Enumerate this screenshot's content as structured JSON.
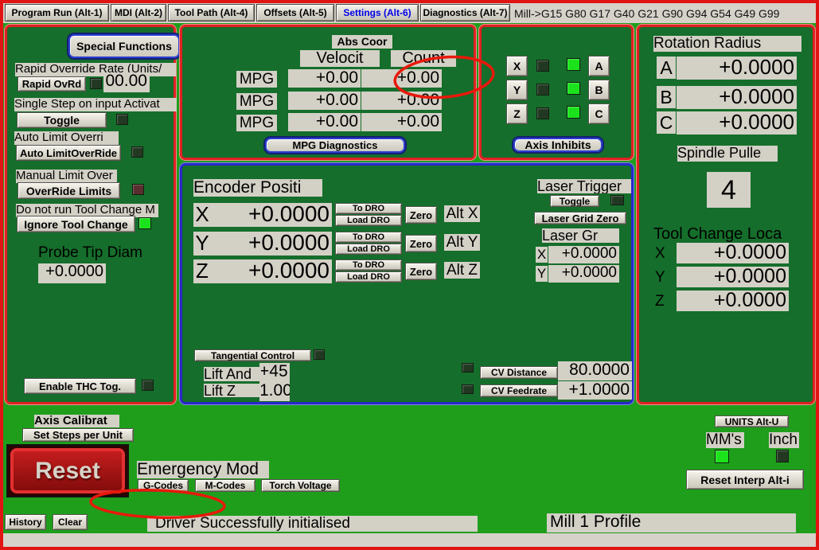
{
  "tabs": [
    {
      "label": "Program Run (Alt-1)"
    },
    {
      "label": "MDI (Alt-2)"
    },
    {
      "label": "Tool Path (Alt-4)"
    },
    {
      "label": "Offsets (Alt-5)"
    },
    {
      "label": "Settings (Alt-6)"
    },
    {
      "label": "Diagnostics (Alt-7)"
    }
  ],
  "gcode_line": "Mill->G15  G80 G17 G40 G21 G90 G94 G54 G49 G99",
  "special_functions": {
    "title": "Special Functions",
    "rapid_override_label": "Rapid Override Rate (Units/",
    "rapid_ovrd_button": "Rapid OvRd",
    "rapid_ovrd_value": "00.00",
    "single_step_label": "Single Step on input Activat",
    "single_step_button": "Toggle",
    "auto_limit_label": "Auto Limit Overri",
    "auto_limit_button": "Auto LimitOverRide",
    "manual_limit_label": "Manual Limit Over",
    "manual_limit_button": "OverRide Limits",
    "tool_change_label": "Do not run Tool Change M",
    "tool_change_button": "Ignore Tool Change",
    "probe_tip_label": "Probe Tip Diam",
    "probe_tip_value": "+0.0000",
    "thc_button": "Enable THC Tog."
  },
  "mpg": {
    "title": "Abs Coor",
    "velocity_header": "Velocit",
    "count_header": "Count",
    "rows": [
      {
        "label": "MPG",
        "velocity": "+0.00",
        "count": "+0.00"
      },
      {
        "label": "MPG",
        "velocity": "+0.00",
        "count": "+0.00"
      },
      {
        "label": "MPG",
        "velocity": "+0.00",
        "count": "+0.00"
      }
    ],
    "diagnostics_button": "MPG Diagnostics"
  },
  "axis_inhibits": {
    "left_axes": [
      "X",
      "Y",
      "Z"
    ],
    "right_axes": [
      "A",
      "B",
      "C"
    ],
    "title_button": "Axis Inhibits"
  },
  "rotation": {
    "title": "Rotation Radius",
    "rows": [
      {
        "axis": "A",
        "value": "+0.0000"
      },
      {
        "axis": "B",
        "value": "+0.0000"
      },
      {
        "axis": "C",
        "value": "+0.0000"
      }
    ],
    "spindle_label": "Spindle Pulle",
    "spindle_value": "4"
  },
  "tool_change": {
    "title": "Tool Change Loca",
    "rows": [
      {
        "axis": "X",
        "value": "+0.0000"
      },
      {
        "axis": "Y",
        "value": "+0.0000"
      },
      {
        "axis": "Z",
        "value": "+0.0000"
      }
    ]
  },
  "encoder": {
    "title": "Encoder Positi",
    "rows": [
      {
        "axis": "X",
        "value": "+0.0000",
        "to_dro": "To DRO",
        "load_dro": "Load DRO",
        "zero": "Zero",
        "alt": "Alt X"
      },
      {
        "axis": "Y",
        "value": "+0.0000",
        "to_dro": "To DRO",
        "load_dro": "Load DRO",
        "zero": "Zero",
        "alt": "Alt Y"
      },
      {
        "axis": "Z",
        "value": "+0.0000",
        "to_dro": "To DRO",
        "load_dro": "Load DRO",
        "zero": "Zero",
        "alt": "Alt Z"
      }
    ]
  },
  "laser": {
    "trigger_label": "Laser Trigger",
    "toggle_button": "Toggle",
    "grid_zero_button": "Laser Grid Zero",
    "grid_label": "Laser Gr",
    "x_label": "X",
    "x_value": "+0.0000",
    "y_label": "Y",
    "y_value": "+0.0000"
  },
  "tangential": {
    "button": "Tangential Control",
    "lift_angle_label": "Lift And",
    "lift_angle_value": "+45",
    "lift_z_label": "Lift Z",
    "lift_z_value": "1.00"
  },
  "cv": {
    "distance_button": "CV Distance",
    "distance_value": "80.0000",
    "feedrate_button": "CV Feedrate",
    "feedrate_value": "+1.0000"
  },
  "bottom": {
    "axis_calibration_label": "Axis Calibrat",
    "set_steps_button": "Set Steps per Unit",
    "reset_button": "Reset",
    "emergency_label": "Emergency Mod",
    "gcodes_button": "G-Codes",
    "mcodes_button": "M-Codes",
    "torch_button": "Torch Voltage",
    "units_button": "UNITS Alt-U",
    "mm_label": "MM's",
    "inch_label": "Inch",
    "reset_interp_button": "Reset Interp Alt-i",
    "history_button": "History",
    "clear_button": "Clear",
    "status_text": "Driver Successfully initialised",
    "profile_text": "Mill  1  Profile"
  },
  "colors": {
    "background_green": "#1f9e1c",
    "panel_green": "#156e2b",
    "window_border_red": "#e11414",
    "panel_border_red": "#df2121",
    "encoder_border_blue": "#2628c8",
    "ui_gray": "#d3d0c6",
    "led_on": "#1be31b",
    "led_off": "#233823",
    "led_maroon": "#5a2e2e",
    "tab_active_blue": "#0000e8",
    "annotation_red": "#e8190b"
  }
}
